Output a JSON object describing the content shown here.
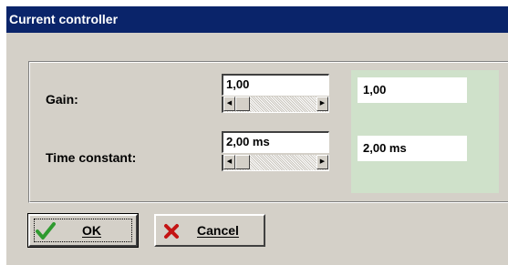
{
  "window": {
    "title": "Current controller"
  },
  "gain": {
    "label": "Gain:",
    "value": "1,00",
    "readout": "1,00",
    "slider_position": 0.02
  },
  "time_constant": {
    "label": "Time constant:",
    "value": "2,00 ms",
    "readout": "2,00 ms",
    "slider_position": 0.02
  },
  "buttons": {
    "ok_label": "OK",
    "cancel_label": "Cancel"
  },
  "icons": {
    "ok": "checkmark-icon",
    "cancel": "red-x-icon",
    "scroll_left": "arrow-left-icon",
    "scroll_right": "arrow-right-icon"
  },
  "colors": {
    "titlebar": "#0a246a",
    "readout_panel": "#cfe1ca",
    "ok_check": "#2f9a2f",
    "cancel_x": "#c41414"
  }
}
